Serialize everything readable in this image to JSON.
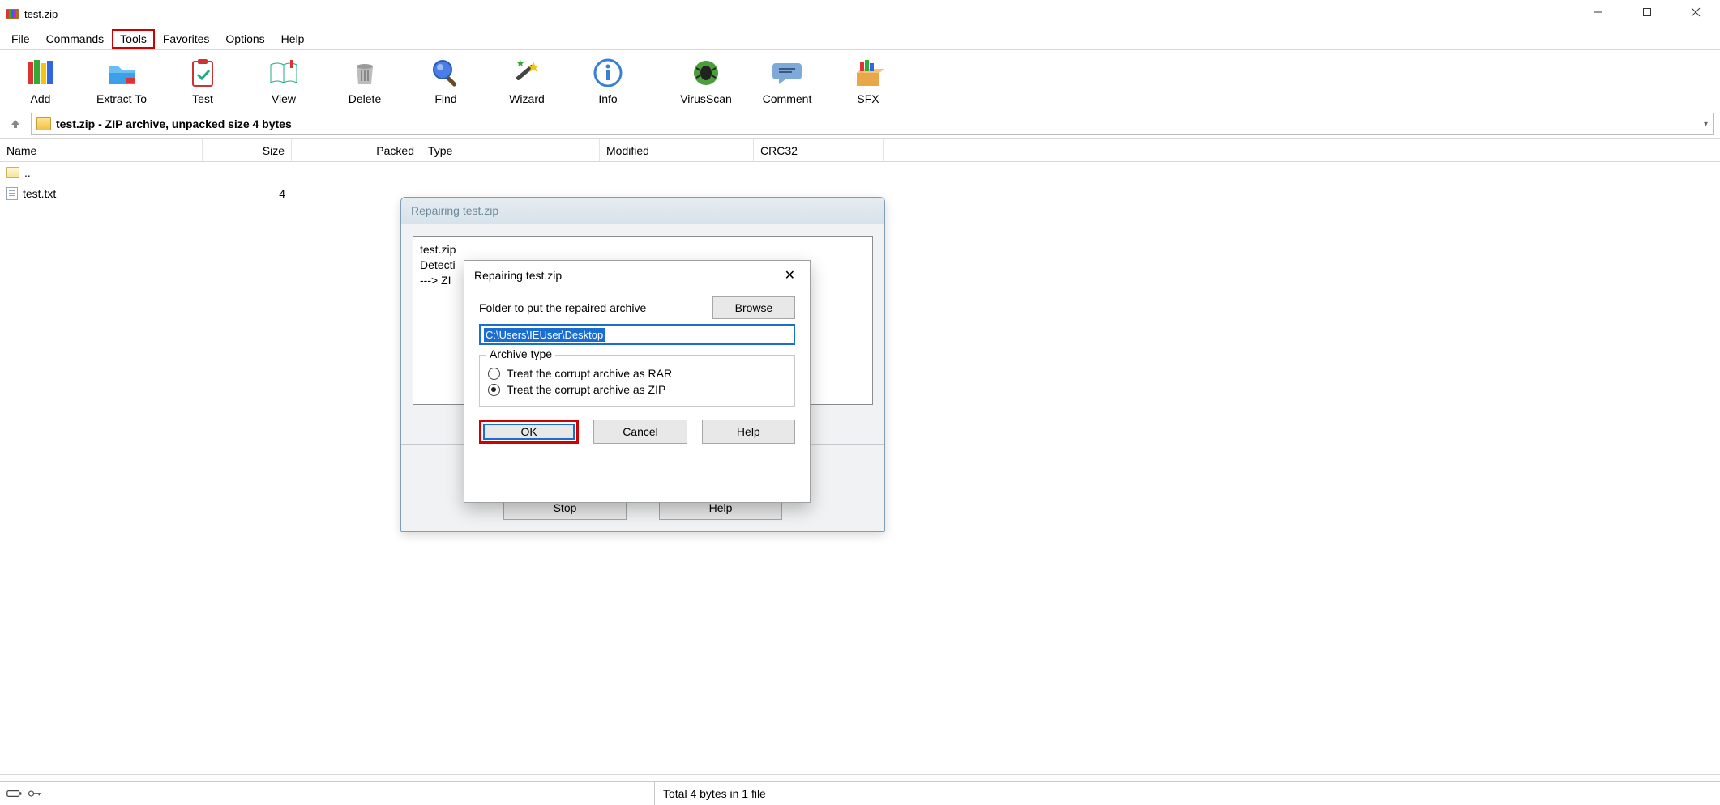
{
  "window": {
    "title": "test.zip"
  },
  "menu": {
    "file": "File",
    "commands": "Commands",
    "tools": "Tools",
    "favorites": "Favorites",
    "options": "Options",
    "help": "Help"
  },
  "toolbar": {
    "add": "Add",
    "extract": "Extract To",
    "test": "Test",
    "view": "View",
    "delete": "Delete",
    "find": "Find",
    "wizard": "Wizard",
    "info": "Info",
    "virusscan": "VirusScan",
    "comment": "Comment",
    "sfx": "SFX"
  },
  "address": {
    "path": "test.zip - ZIP archive, unpacked size 4 bytes"
  },
  "columns": {
    "name": "Name",
    "size": "Size",
    "packed": "Packed",
    "type": "Type",
    "modified": "Modified",
    "crc32": "CRC32"
  },
  "files": {
    "parent": "..",
    "rows": [
      {
        "name": "test.txt",
        "size": "4"
      }
    ]
  },
  "dialog1": {
    "title": "Repairing test.zip",
    "log_line1": "test.zip",
    "log_line2": "Detecti",
    "log_line3": "---> ZI",
    "stop": "Stop",
    "help": "Help"
  },
  "dialog2": {
    "title": "Repairing test.zip",
    "folder_label": "Folder to put the repaired archive",
    "browse": "Browse",
    "path_value": "C:\\Users\\IEUser\\Desktop",
    "group_title": "Archive type",
    "radio_rar": "Treat the corrupt archive as RAR",
    "radio_zip": "Treat the corrupt archive as ZIP",
    "ok": "OK",
    "cancel": "Cancel",
    "help": "Help"
  },
  "status": {
    "total": "Total 4 bytes in 1 file"
  }
}
